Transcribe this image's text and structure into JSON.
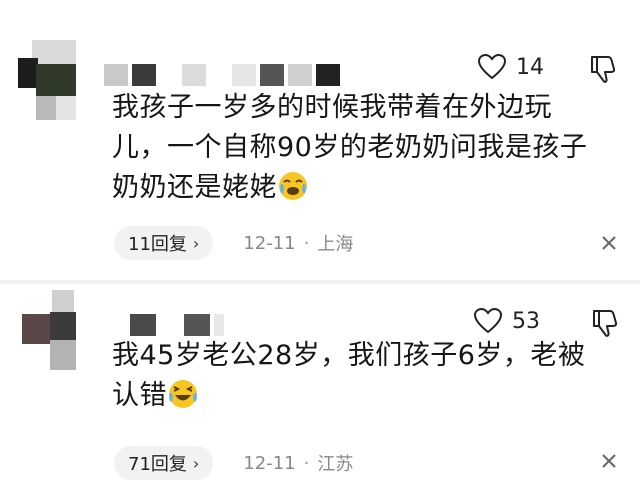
{
  "comments": [
    {
      "avatar": "blurred-avatar",
      "username_blurred": true,
      "likes": "14",
      "text_lines": [
        "我孩子一岁多的时候我带着在外边玩",
        "儿，一个自称90岁的老奶奶问我是孩子",
        "奶奶还是姥姥"
      ],
      "emoji": "crying-laughing-emoji",
      "reply_label": "11回复",
      "reply_chevron": "›",
      "date": "12-11",
      "dot": "·",
      "location": "上海"
    },
    {
      "avatar": "blurred-avatar",
      "username_blurred": true,
      "likes": "53",
      "text_lines": [
        "我45岁老公28岁，我们孩子6岁，老被",
        "认错"
      ],
      "emoji": "laughing-tears-emoji",
      "reply_label": "71回复",
      "reply_chevron": "›",
      "date": "12-11",
      "dot": "·",
      "location": "江苏"
    }
  ],
  "icons": {
    "like": "heart-outline-icon",
    "dislike": "thumbs-down-icon",
    "close": "close-icon"
  },
  "colors": {
    "text": "#161616",
    "meta": "#888888",
    "reply_bg": "#f2f2f2",
    "emoji_yellow": "#f7c623"
  }
}
